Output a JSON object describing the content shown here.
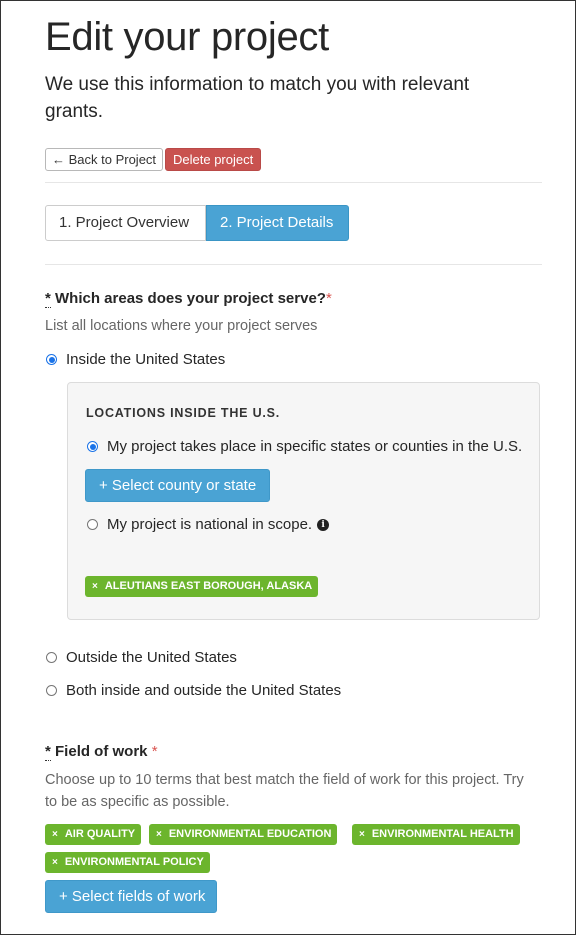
{
  "header": {
    "title": "Edit your project",
    "subtitle": "We use this information to match you with relevant grants."
  },
  "actions": {
    "back_label": "← Back to Project",
    "delete_label": "Delete project"
  },
  "tabs": [
    {
      "label": "1. Project Overview",
      "active": false
    },
    {
      "label": "2. Project Details",
      "active": true
    }
  ],
  "areas": {
    "asterisk": "*",
    "question": "Which areas does your project serve?",
    "required_mark": "*",
    "hint": "List all locations where your project serves",
    "options": [
      {
        "label": "Inside the United States",
        "selected": true
      },
      {
        "label": "Outside the United States",
        "selected": false
      },
      {
        "label": "Both inside and outside the United States",
        "selected": false
      }
    ],
    "us_panel": {
      "heading": "LOCATIONS INSIDE THE U.S.",
      "options": [
        {
          "label": "My project takes place in specific states or counties in the U.S.",
          "selected": true
        },
        {
          "label": "My project is national in scope.",
          "selected": false
        }
      ],
      "info_icon": "info-icon",
      "select_button_label": "+ Select county or state",
      "selected_locations": [
        "ALEUTIANS EAST BOROUGH, ALASKA"
      ]
    }
  },
  "field_of_work": {
    "asterisk": "*",
    "question": "Field of work",
    "required_mark": "*",
    "hint": "Choose up to 10 terms that best match the field of work for this project. Try to be as specific as possible.",
    "tags": [
      "AIR QUALITY",
      "ENVIRONMENTAL EDUCATION",
      "ENVIRONMENTAL HEALTH",
      "ENVIRONMENTAL POLICY"
    ],
    "select_button_label": "+ Select fields of work"
  },
  "tag_remove_glyph": "×",
  "colors": {
    "primary": "#4aa3d4",
    "danger": "#c9524f",
    "tag": "#6cb52d",
    "required": "#d9534f",
    "radio_selected": "#1a73e8"
  }
}
